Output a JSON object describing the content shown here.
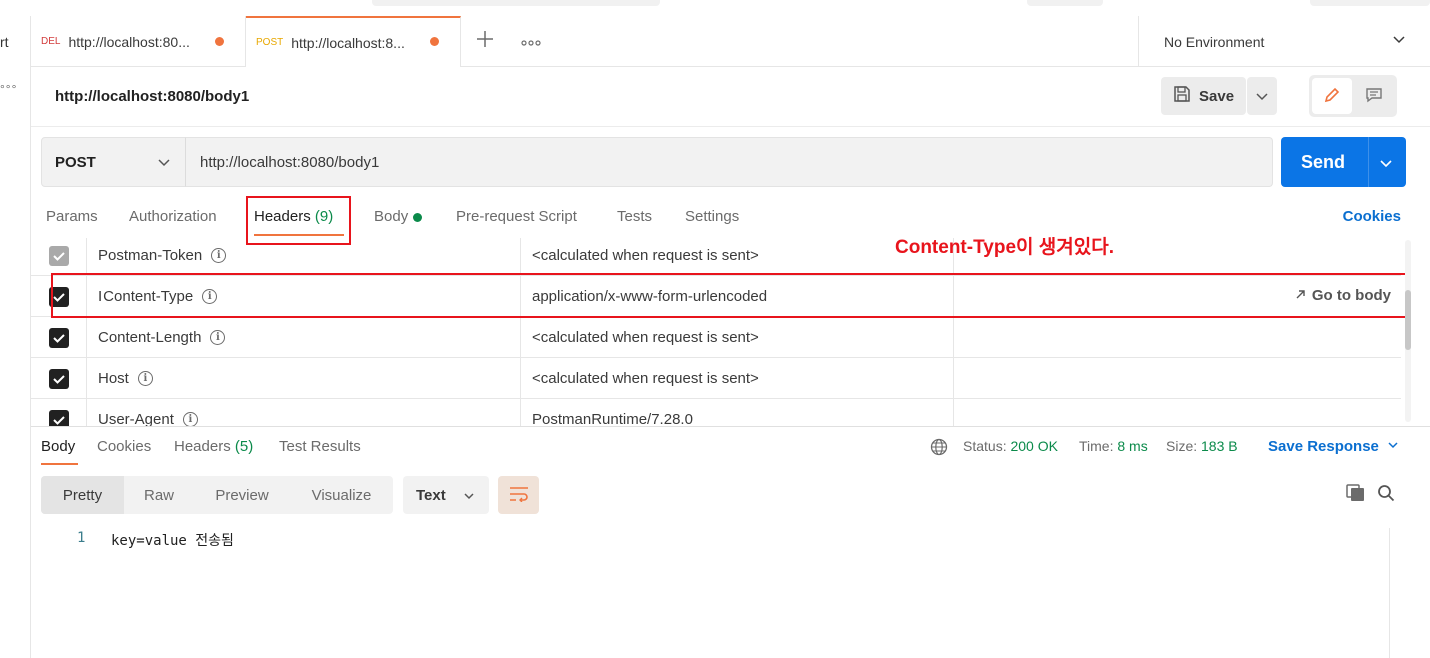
{
  "sidebar": {
    "fragment_label": "rt",
    "more_icon": "more-dots-icon"
  },
  "tabs": [
    {
      "method": "DEL",
      "method_color": "#d23b3b",
      "url": "http://localhost:80...",
      "unsaved": true
    },
    {
      "method": "POST",
      "method_color": "#e8a800",
      "url": "http://localhost:8...",
      "unsaved": true,
      "active": true
    }
  ],
  "tabs_actions": {
    "add_icon": "plus-icon",
    "more_icon": "more-dots-icon"
  },
  "environment": {
    "label": "No Environment"
  },
  "request": {
    "title": "http://localhost:8080/body1",
    "save_label": "Save",
    "method": "POST",
    "url": "http://localhost:8080/body1",
    "send_label": "Send"
  },
  "request_tabs": {
    "params": "Params",
    "authorization": "Authorization",
    "headers": "Headers",
    "headers_count": "(9)",
    "body": "Body",
    "pre_request": "Pre-request Script",
    "tests": "Tests",
    "settings": "Settings",
    "cookies": "Cookies"
  },
  "annotation": "Content-Type이 생겨있다.",
  "headers": [
    {
      "key": "Postman-Token",
      "value": "<calculated when request is sent>",
      "checked": true,
      "disabled": true
    },
    {
      "key": "Content-Type",
      "value": "application/x-www-form-urlencoded",
      "checked": true,
      "action": "Go to body"
    },
    {
      "key": "Content-Length",
      "value": "<calculated when request is sent>",
      "checked": true
    },
    {
      "key": "Host",
      "value": "<calculated when request is sent>",
      "checked": true
    },
    {
      "key": "User-Agent",
      "value": "PostmanRuntime/7.28.0",
      "checked": true
    }
  ],
  "response": {
    "tabs": {
      "body": "Body",
      "cookies": "Cookies",
      "headers": "Headers",
      "headers_count": "(5)",
      "test_results": "Test Results"
    },
    "status_label": "Status:",
    "status_value": "200 OK",
    "time_label": "Time:",
    "time_value": "8 ms",
    "size_label": "Size:",
    "size_value": "183 B",
    "save_response": "Save Response",
    "formats": [
      "Pretty",
      "Raw",
      "Preview",
      "Visualize"
    ],
    "language": "Text",
    "line_number": "1",
    "line_text": "key=value 전송됨"
  },
  "colors": {
    "accent": "#f0743e",
    "send": "#0b75e6",
    "success": "#0b8a4a",
    "highlight": "#e8141c",
    "link": "#0b6fd0"
  }
}
